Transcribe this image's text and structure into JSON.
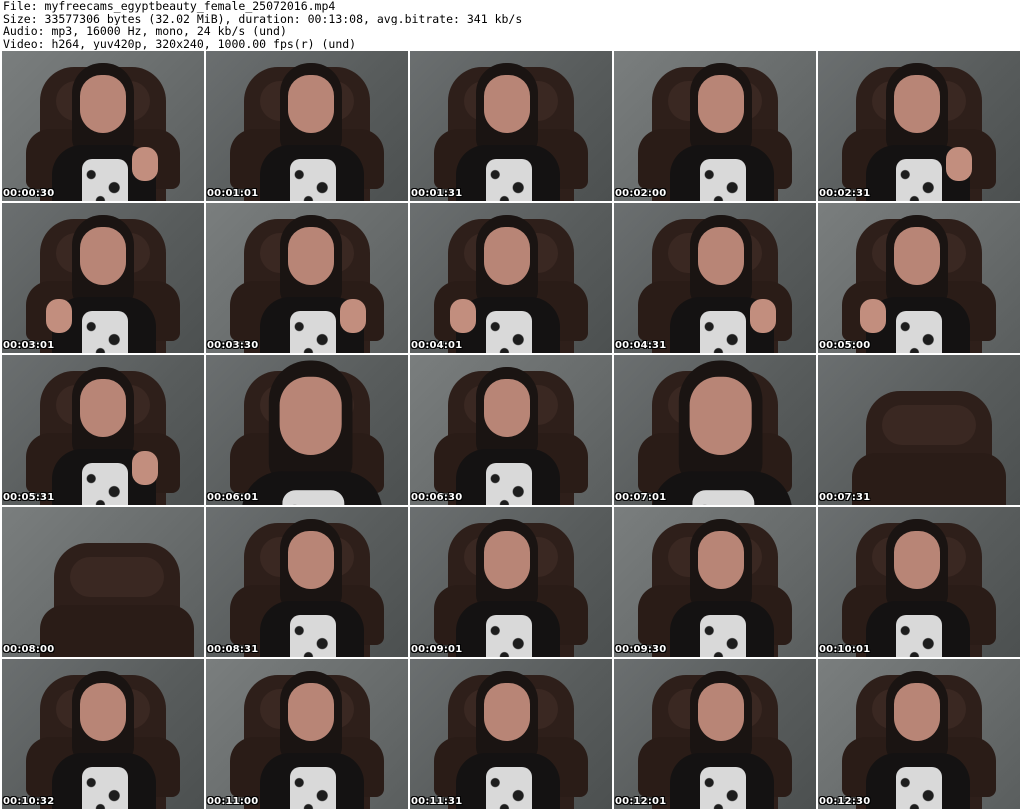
{
  "header": {
    "file_line": "File: myfreecams_egyptbeauty_female_25072016.mp4",
    "size_line": "Size: 33577306 bytes (32.02 MiB), duration: 00:13:08, avg.bitrate: 341 kb/s",
    "audio_line": "Audio: mp3, 16000 Hz, mono, 24 kb/s (und)",
    "video_line": "Video: h264, yuv420p, 320x240, 1000.00 fps(r) (und)"
  },
  "thumbnails": [
    {
      "timestamp": "00:00:30"
    },
    {
      "timestamp": "00:01:01"
    },
    {
      "timestamp": "00:01:31"
    },
    {
      "timestamp": "00:02:00"
    },
    {
      "timestamp": "00:02:31"
    },
    {
      "timestamp": "00:03:01"
    },
    {
      "timestamp": "00:03:30"
    },
    {
      "timestamp": "00:04:01"
    },
    {
      "timestamp": "00:04:31"
    },
    {
      "timestamp": "00:05:00"
    },
    {
      "timestamp": "00:05:31"
    },
    {
      "timestamp": "00:06:01"
    },
    {
      "timestamp": "00:06:30"
    },
    {
      "timestamp": "00:07:01"
    },
    {
      "timestamp": "00:07:31"
    },
    {
      "timestamp": "00:08:00"
    },
    {
      "timestamp": "00:08:31"
    },
    {
      "timestamp": "00:09:01"
    },
    {
      "timestamp": "00:09:30"
    },
    {
      "timestamp": "00:10:01"
    },
    {
      "timestamp": "00:10:32"
    },
    {
      "timestamp": "00:11:00"
    },
    {
      "timestamp": "00:11:31"
    },
    {
      "timestamp": "00:12:01"
    },
    {
      "timestamp": "00:12:30"
    }
  ],
  "colors": {
    "background": "#ffffff",
    "timestamp_text": "#ffffff",
    "header_text": "#000000"
  }
}
